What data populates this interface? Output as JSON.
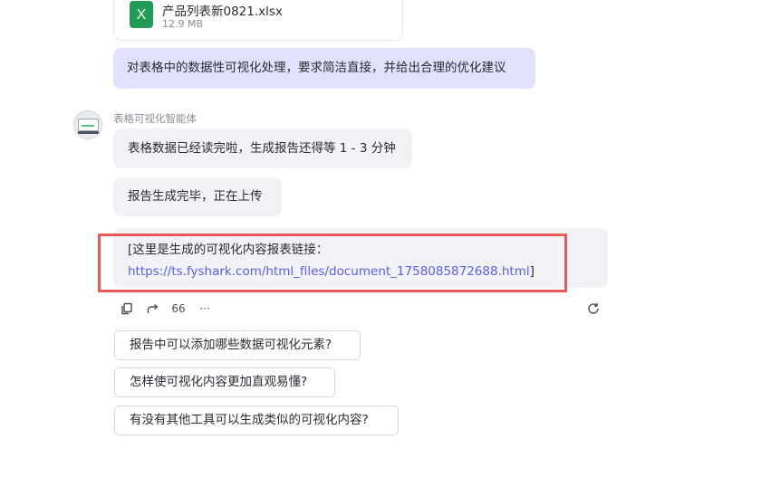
{
  "file": {
    "icon": "excel-file-icon",
    "icon_letter": "X",
    "name": "产品列表新0821.xlsx",
    "size": "12.9 MB",
    "icon_color": "#1f9d57"
  },
  "user_message": "对表格中的数据性可视化处理，要求简洁直接，并给出合理的优化建议",
  "agent": {
    "name": "表格可视化智能体",
    "avatar_icon": "monitor-chart-avatar",
    "messages": [
      "表格数据已经读完啦，生成报告还得等 1 - 3 分钟",
      "报告生成完毕，正在上传"
    ],
    "link_message": {
      "prefix": "[这里是生成的可视化内容报表链接：",
      "url": "https://ts.fyshark.com/html_files/document_1758085872688.html",
      "suffix": "]"
    }
  },
  "actions": {
    "copy_icon": "copy-icon",
    "share_icon": "share-icon",
    "quote_label": "66",
    "more_label": "···",
    "refresh_icon": "refresh-icon"
  },
  "suggestions": [
    "报告中可以添加哪些数据可视化元素?",
    "怎样使可视化内容更加直观易懂?",
    "有没有其他工具可以生成类似的可视化内容?"
  ],
  "colors": {
    "user_bubble": "#dfe1fd",
    "agent_bubble": "#f1f2f6",
    "link": "#5b5ff0",
    "highlight_border": "#e85a5a"
  }
}
